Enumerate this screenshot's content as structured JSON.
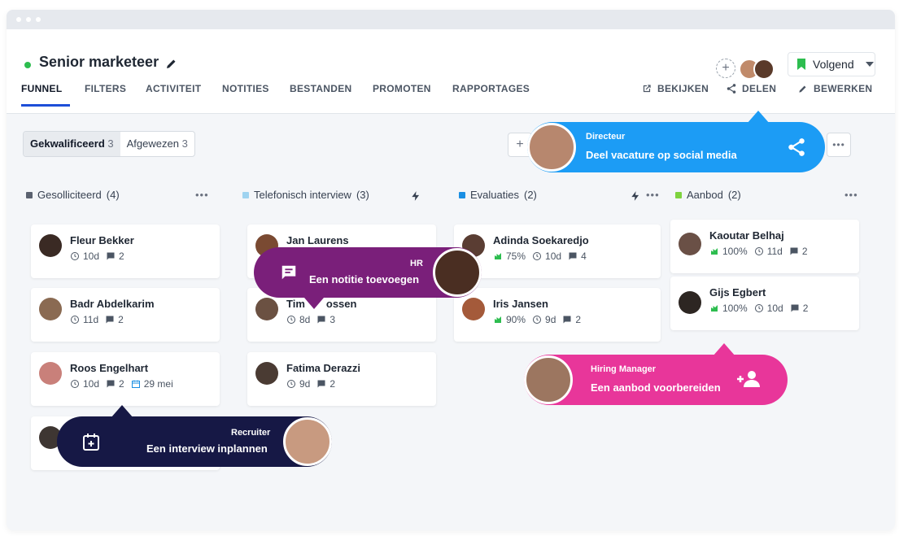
{
  "header": {
    "job_title": "Senior marketeer",
    "tabs": [
      "FUNNEL",
      "FILTERS",
      "ACTIVITEIT",
      "NOTITIES",
      "BESTANDEN",
      "PROMOTEN",
      "RAPPORTAGES"
    ],
    "active_tab": "FUNNEL",
    "actions": {
      "view": "BEKIJKEN",
      "share": "DELEN",
      "edit": "BEWERKEN"
    },
    "follow_label": "Volgend",
    "status_color": "#2dbd4f"
  },
  "filters": {
    "qualified_label": "Gekwalificeerd",
    "qualified_count": "3",
    "rejected_label": "Afgewezen",
    "rejected_count": "3"
  },
  "columns": [
    {
      "title": "Gesolliciteerd",
      "count": "(4)",
      "color": "#5b6270"
    },
    {
      "title": "Telefonisch interview",
      "count": "(3)",
      "color": "#9fd3f0"
    },
    {
      "title": "Evaluaties",
      "count": "(2)",
      "color": "#1a8fe3"
    },
    {
      "title": "Aanbod",
      "count": "(2)",
      "color": "#7ed33f"
    }
  ],
  "cards": {
    "c0": {
      "name": "Fleur Bekker",
      "days": "10d",
      "comments": "2"
    },
    "c1": {
      "name": "Badr Abdelkarim",
      "days": "11d",
      "comments": "2"
    },
    "c2": {
      "name": "Roos Engelhart",
      "days": "10d",
      "comments": "2",
      "date": "29 mei"
    },
    "t0": {
      "name": "Jan Laurens"
    },
    "t1": {
      "name": "Tim",
      "name_end": "ossen",
      "days": "8d",
      "comments": "3"
    },
    "t2": {
      "name": "Fatima Derazzi",
      "days": "9d",
      "comments": "2"
    },
    "e0": {
      "name": "Adinda Soekaredjo",
      "score": "75%",
      "days": "10d",
      "comments": "4"
    },
    "e1": {
      "name": "Iris Jansen",
      "score": "90%",
      "days": "9d",
      "comments": "2"
    },
    "a0": {
      "name": "Kaoutar Belhaj",
      "score": "100%",
      "days": "11d",
      "comments": "2"
    },
    "a1": {
      "name": "Gijs Egbert",
      "score": "100%",
      "days": "10d",
      "comments": "2"
    }
  },
  "bubbles": {
    "director": {
      "role": "Directeur",
      "message": "Deel vacature op social media",
      "color": "#1c9cf5"
    },
    "hr": {
      "role": "HR",
      "message": "Een notitie toevoegen",
      "color": "#7a1f7a"
    },
    "hiring": {
      "role": "Hiring Manager",
      "message": "Een aanbod voorbereiden",
      "color": "#e8369a"
    },
    "recruiter": {
      "role": "Recruiter",
      "message": "Een interview inplannen",
      "color": "#161845"
    }
  }
}
